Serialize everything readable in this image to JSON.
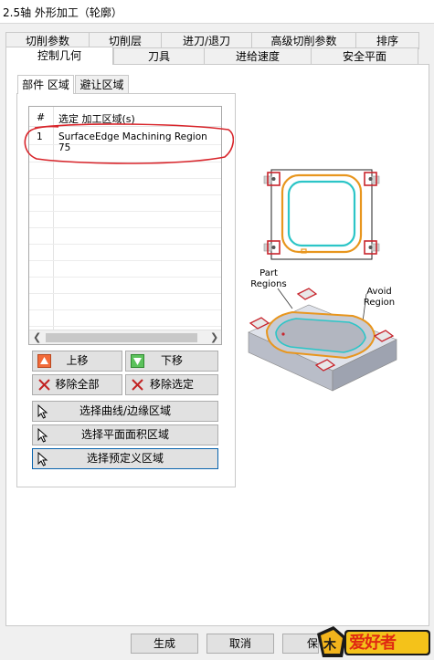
{
  "window": {
    "title": "2.5轴 外形加工（轮廓）"
  },
  "tabs_row1": [
    {
      "label": "切削参数"
    },
    {
      "label": "切削层"
    },
    {
      "label": "进刀/退刀"
    },
    {
      "label": "高级切削参数"
    },
    {
      "label": "排序"
    }
  ],
  "tabs_row2": [
    {
      "label": "控制几何",
      "active": true
    },
    {
      "label": "刀具"
    },
    {
      "label": "进给速度"
    },
    {
      "label": "安全平面"
    }
  ],
  "subtabs": [
    {
      "label": "部件 区域",
      "active": true
    },
    {
      "label": "避让区域"
    }
  ],
  "list": {
    "columns": [
      "#",
      "选定 加工区域(s)"
    ],
    "rows": [
      {
        "index": "1",
        "name": "SurfaceEdge Machining Region 75"
      }
    ]
  },
  "buttons": {
    "move_up": "上移",
    "move_down": "下移",
    "remove_all": "移除全部",
    "remove_selected": "移除选定",
    "select_curves": "选择曲线/边缘区域",
    "select_planar": "选择平面面积区域",
    "select_predefined": "选择预定义区域"
  },
  "diagram": {
    "part_regions": "Part\nRegions",
    "avoid_region": "Avoid\nRegion"
  },
  "bottom": {
    "generate": "生成",
    "cancel": "取消",
    "save": "保"
  },
  "watermark": {
    "text": "爱好者"
  },
  "colors": {
    "orange_toolpath": "#e8961e",
    "cyan_region": "#2cc5c7",
    "red_marker": "#c8252d",
    "annotation_red": "#d8242a",
    "focus_blue": "#0a64ad"
  },
  "icons": {
    "move_up": "red-up-triangle-icon",
    "move_down": "green-down-triangle-icon",
    "remove": "x-icon",
    "select": "pointer-arrow-icon"
  }
}
